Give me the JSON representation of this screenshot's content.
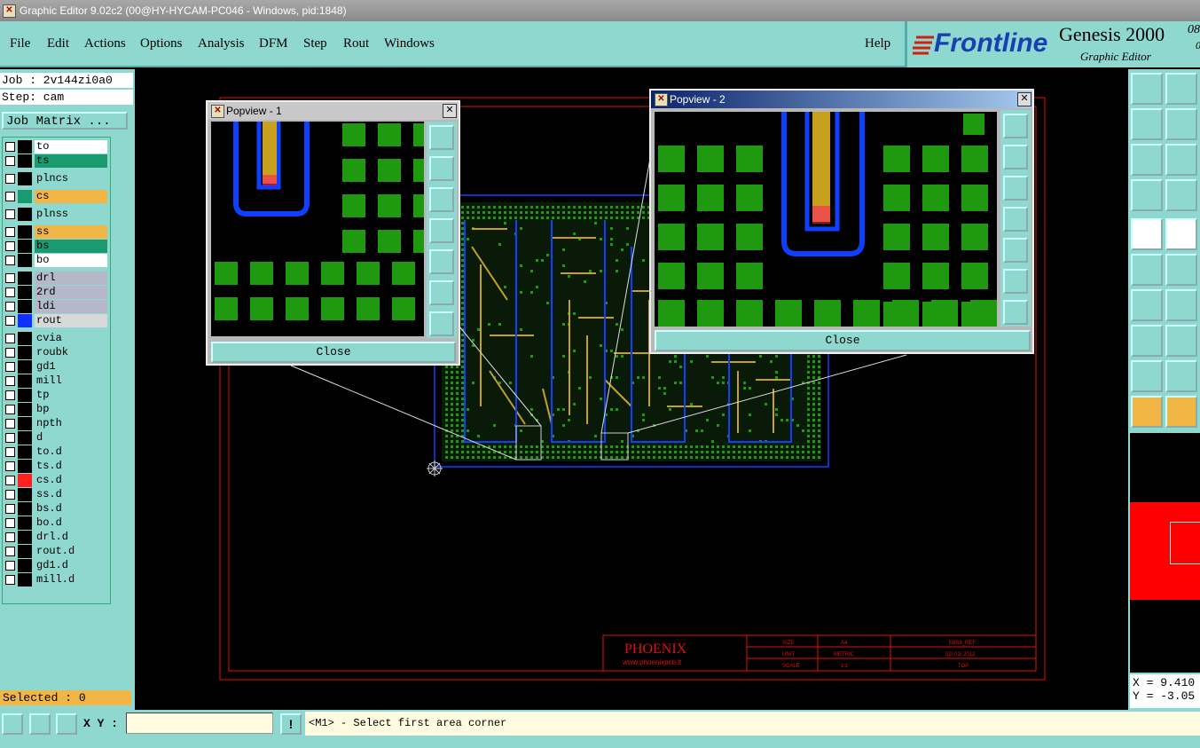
{
  "window": {
    "title": "Graphic Editor 9.02c2 (00@HY-HYCAM-PC046 - Windows, pid:1848)"
  },
  "menu": {
    "file": "File",
    "edit": "Edit",
    "actions": "Actions",
    "options": "Options",
    "analysis": "Analysis",
    "dfm": "DFM",
    "step": "Step",
    "rout": "Rout",
    "windows": "Windows",
    "help": "Help"
  },
  "brand": {
    "logo": "Frontline",
    "product": "Genesis 2000",
    "version_sup": "08",
    "version_sub": "0",
    "subtitle": "Graphic Editor"
  },
  "job": {
    "job_line": "Job : 2v144zi0a0",
    "step_line": "Step: cam",
    "matrix_button": "Job Matrix ..."
  },
  "layers": [
    {
      "name": "to",
      "color": "#000000",
      "bg": "#ffffff"
    },
    {
      "name": "ts",
      "color": "#000000",
      "bg": "#1a9a70"
    },
    {
      "name": "plncs",
      "color": "#000000",
      "bg": "#8fd8d0"
    },
    {
      "name": "cs",
      "color": "#1a9a70",
      "bg": "#f2b646"
    },
    {
      "name": "plnss",
      "color": "#000000",
      "bg": "#8fd8d0"
    },
    {
      "name": "ss",
      "color": "#000000",
      "bg": "#f2b646"
    },
    {
      "name": "bs",
      "color": "#000000",
      "bg": "#1a9a70"
    },
    {
      "name": "bo",
      "color": "#000000",
      "bg": "#ffffff"
    },
    {
      "name": "drl",
      "color": "#000000",
      "bg": "#b4b8c8"
    },
    {
      "name": "2rd",
      "color": "#000000",
      "bg": "#b4b8c8"
    },
    {
      "name": "ldi",
      "color": "#000000",
      "bg": "#b4b8c8"
    },
    {
      "name": "rout",
      "color": "#1030ff",
      "bg": "#d8d8d8"
    },
    {
      "name": "cvia",
      "color": "#000000",
      "bg": "#8fd8d0"
    },
    {
      "name": "roubk",
      "color": "#000000",
      "bg": "#8fd8d0"
    },
    {
      "name": "gd1",
      "color": "#000000",
      "bg": "#8fd8d0"
    },
    {
      "name": "mill",
      "color": "#000000",
      "bg": "#8fd8d0"
    },
    {
      "name": "tp",
      "color": "#000000",
      "bg": "#8fd8d0"
    },
    {
      "name": "bp",
      "color": "#000000",
      "bg": "#8fd8d0"
    },
    {
      "name": "npth",
      "color": "#000000",
      "bg": "#8fd8d0"
    },
    {
      "name": "d",
      "color": "#000000",
      "bg": "#8fd8d0"
    },
    {
      "name": "to.d",
      "color": "#000000",
      "bg": "#8fd8d0"
    },
    {
      "name": "ts.d",
      "color": "#000000",
      "bg": "#8fd8d0"
    },
    {
      "name": "cs.d",
      "color": "#ff2020",
      "bg": "#8fd8d0"
    },
    {
      "name": "ss.d",
      "color": "#000000",
      "bg": "#8fd8d0"
    },
    {
      "name": "bs.d",
      "color": "#000000",
      "bg": "#8fd8d0"
    },
    {
      "name": "bo.d",
      "color": "#000000",
      "bg": "#8fd8d0"
    },
    {
      "name": "drl.d",
      "color": "#000000",
      "bg": "#8fd8d0"
    },
    {
      "name": "rout.d",
      "color": "#000000",
      "bg": "#8fd8d0"
    },
    {
      "name": "gd1.d",
      "color": "#000000",
      "bg": "#8fd8d0"
    },
    {
      "name": "mill.d",
      "color": "#000000",
      "bg": "#8fd8d0"
    }
  ],
  "selected": "Selected : 0",
  "xy": {
    "label": "X Y :",
    "value": ""
  },
  "status": "<M1> - Select first area corner",
  "coords": {
    "x": "X = 9.410",
    "y": "Y = -3.05"
  },
  "popview1": {
    "title": "Popview - 1",
    "close": "Close"
  },
  "popview2": {
    "title": "Popview - 2",
    "close": "Close"
  },
  "titleblock": {
    "company": "PHOENIX",
    "website": "www.phoenixpcb.lt",
    "size_label": "SIZE",
    "size_value": "A4",
    "unit_label": "UNIT",
    "unit_value": "METRIC",
    "scale_label": "SCALE",
    "scale_value": "1:1",
    "doc": "E6S8_REF",
    "date": "02/ 01/ 2012",
    "side": "TOP"
  },
  "colors": {
    "panel": "#8fd8d0",
    "pad_green": "#1f9a10",
    "track_gold": "#c8a020",
    "outline_blue": "#1040ff",
    "frame_red": "#e01010"
  }
}
